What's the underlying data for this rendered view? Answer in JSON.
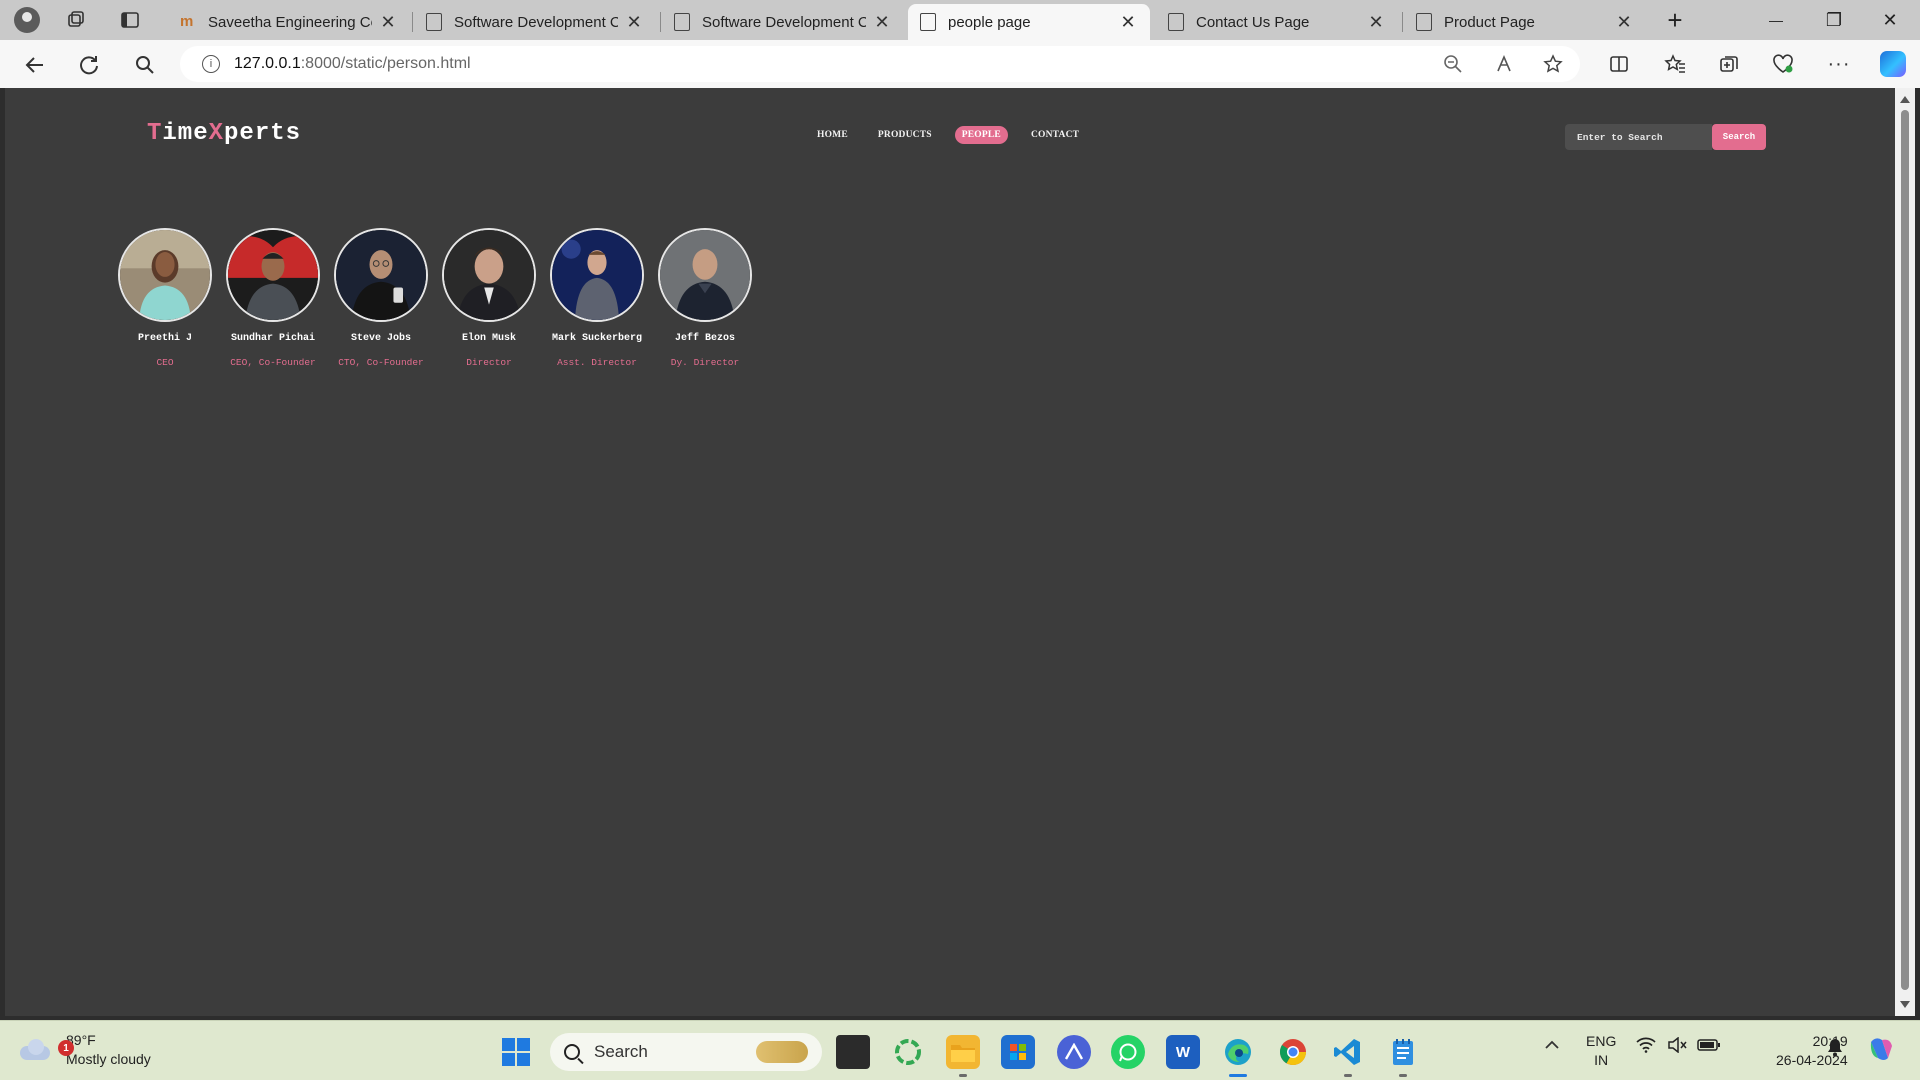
{
  "browser": {
    "tabs": [
      {
        "title": "Saveetha Engineering Co",
        "favicon": "brand-icon"
      },
      {
        "title": "Software Development C",
        "favicon": "page-icon"
      },
      {
        "title": "Software Development C",
        "favicon": "page-icon"
      },
      {
        "title": "people page",
        "favicon": "page-icon",
        "active": true
      },
      {
        "title": "Contact Us Page",
        "favicon": "page-icon"
      },
      {
        "title": "Product Page",
        "favicon": "page-icon"
      }
    ],
    "url_host": "127.0.0.1",
    "url_rest": ":8000/static/person.html",
    "tab_close": "✕",
    "new_tab": "+",
    "win_minimize": "—",
    "win_restore": "❐",
    "win_close": "✕"
  },
  "site": {
    "logo": {
      "t": "T",
      "ime": "ime",
      "x": "X",
      "perts": "perts"
    },
    "nav": [
      "HOME",
      "PRODUCTS",
      "PEOPLE",
      "CONTACT"
    ],
    "search_placeholder": "Enter to Search",
    "search_button": "Search",
    "accent_color": "#e36d8f",
    "background": "#3c3c3c"
  },
  "people": [
    {
      "name": "Preethi J",
      "role": "CEO"
    },
    {
      "name": "Sundhar Pichai",
      "role": "CEO, Co-Founder"
    },
    {
      "name": "Steve Jobs",
      "role": "CTO, Co-Founder"
    },
    {
      "name": "Elon Musk",
      "role": "Director"
    },
    {
      "name": "Mark Suckerberg",
      "role": "Asst. Director"
    },
    {
      "name": "Jeff Bezos",
      "role": "Dy. Director"
    }
  ],
  "taskbar": {
    "weather_badge": "1",
    "temperature": "89°F",
    "condition": "Mostly cloudy",
    "search": "Search",
    "lang_top": "ENG",
    "lang_bottom": "IN",
    "time": "20:19",
    "date": "26-04-2024"
  }
}
